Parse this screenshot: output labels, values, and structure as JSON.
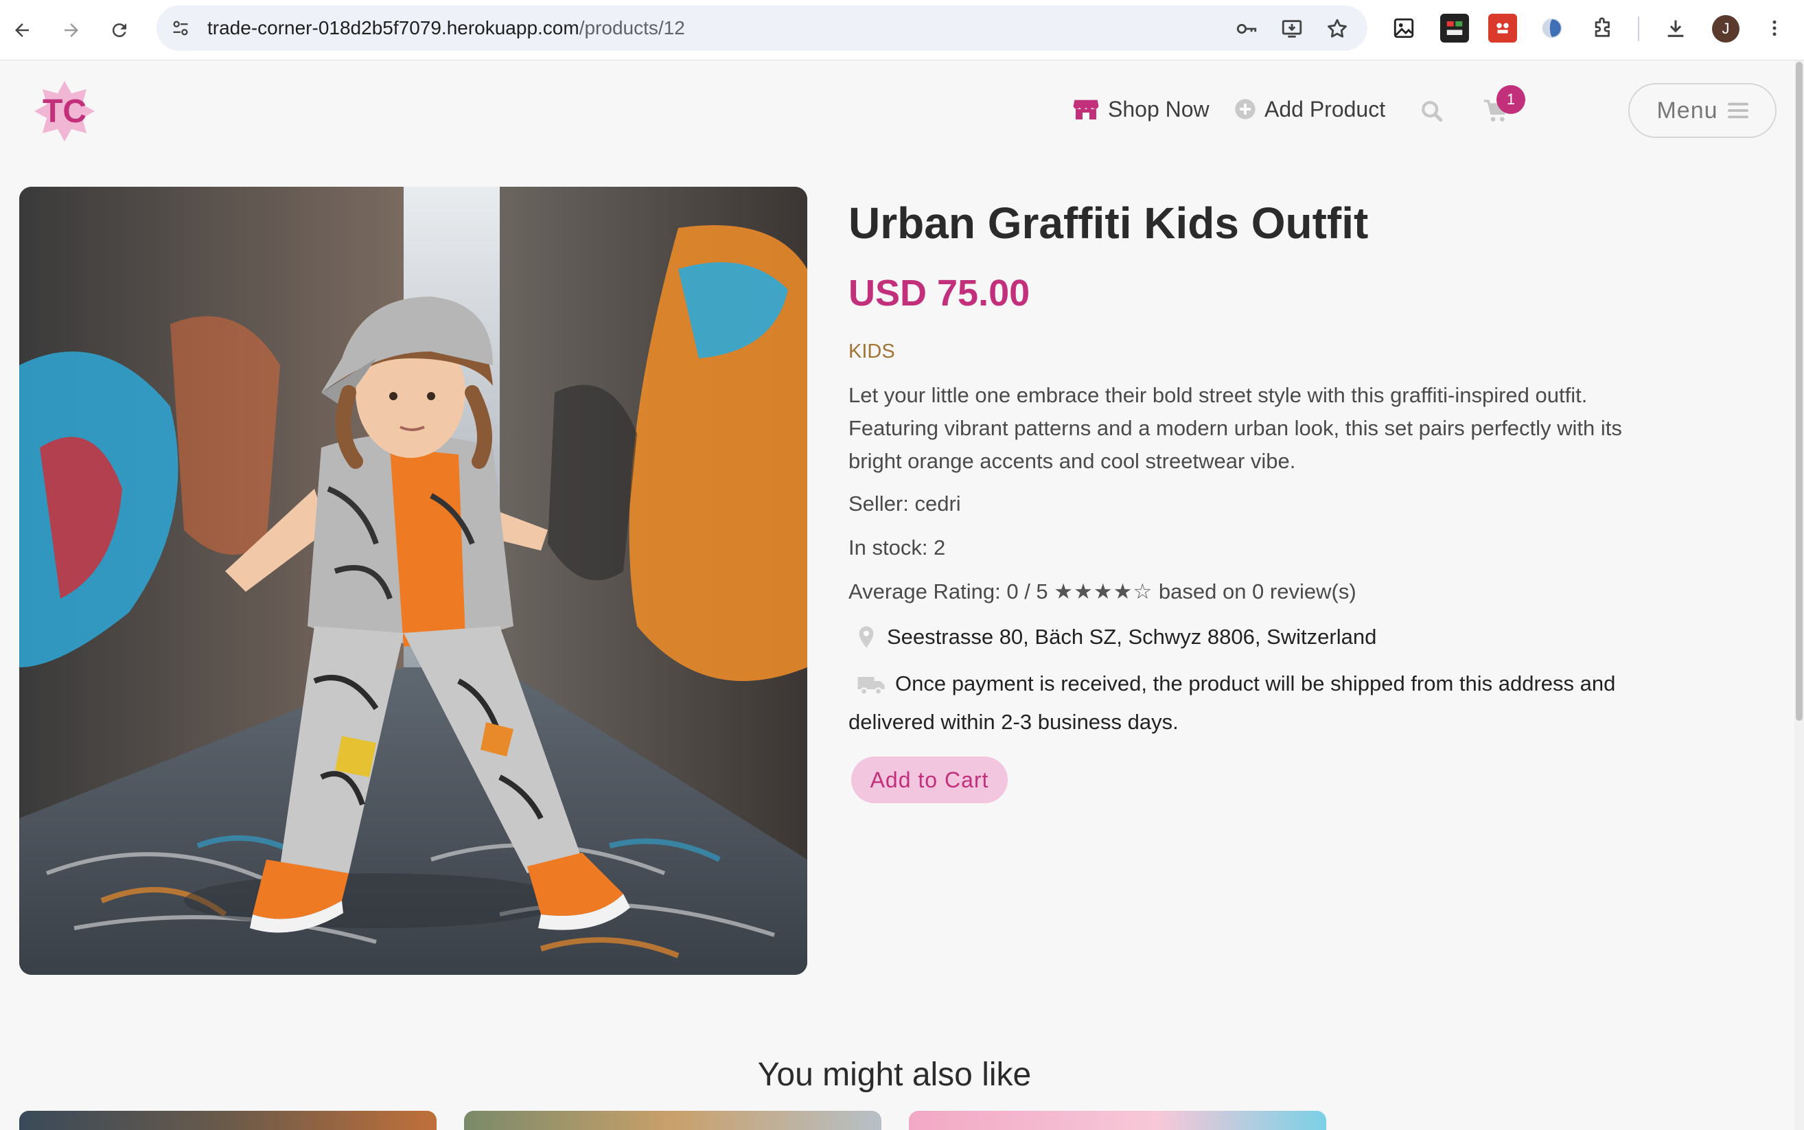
{
  "browser": {
    "url_host": "trade-corner-018d2b5f7079.herokuapp.com",
    "url_path": "/products/12",
    "profile_initial": "J"
  },
  "header": {
    "logo_text": "TC",
    "nav": {
      "shop_now": "Shop Now",
      "add_product": "Add Product"
    },
    "cart_count": "1",
    "menu_label": "Menu"
  },
  "product": {
    "title": "Urban Graffiti Kids Outfit",
    "price": "USD 75.00",
    "category": "KIDS",
    "description": "Let your little one embrace their bold street style with this graffiti-inspired outfit. Featuring vibrant patterns and a modern urban look, this set pairs perfectly with its bright orange accents and cool streetwear vibe.",
    "seller": "Seller: cedri",
    "stock": "In stock: 2",
    "rating_prefix": "Average Rating: 0 / 5",
    "rating_stars": "★★★★☆",
    "rating_suffix": "based on 0 review(s)",
    "address": "Seestrasse 80, Bäch SZ, Schwyz 8806, Switzerland",
    "shipping_note": "Once payment is received, the product will be shipped from this address and delivered within 2-3 business days.",
    "add_to_cart": "Add to Cart"
  },
  "recommendations": {
    "heading": "You might also like"
  },
  "colors": {
    "accent": "#c2307b",
    "button_bg": "#f3c6e0",
    "category": "#a07536"
  },
  "icons": [
    "back-icon",
    "forward-icon",
    "reload-icon",
    "site-settings-icon",
    "password-key-icon",
    "install-app-icon",
    "bookmark-star-icon",
    "image-extension-icon",
    "extensions-puzzle-icon",
    "download-icon",
    "more-vert-icon",
    "store-icon",
    "plus-circle-icon",
    "search-icon",
    "cart-icon",
    "hamburger-icon",
    "map-pin-icon",
    "truck-icon"
  ]
}
